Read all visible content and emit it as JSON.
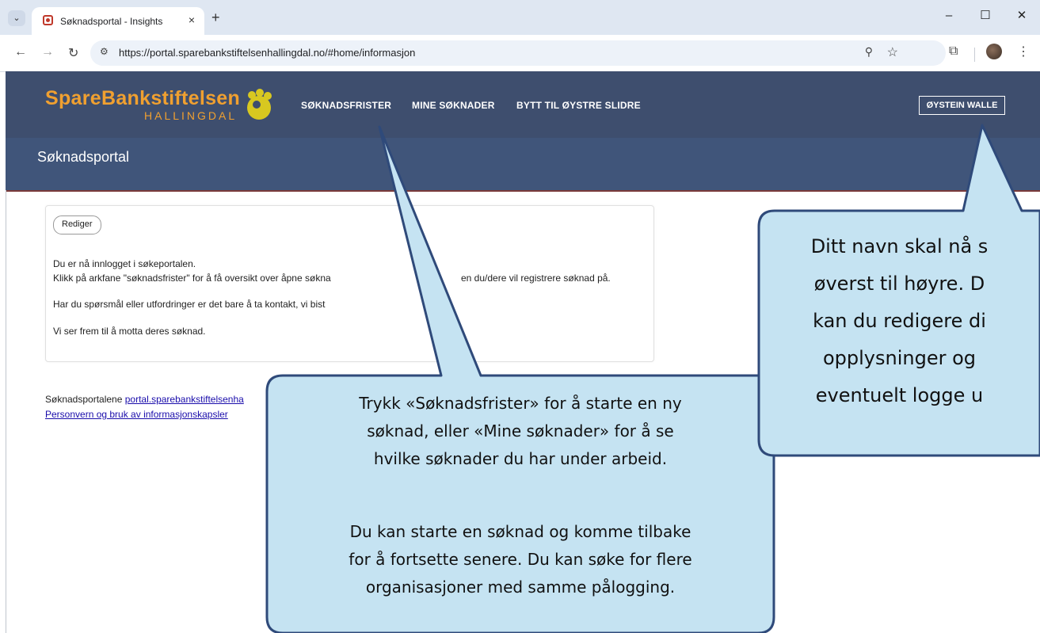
{
  "browser": {
    "tab_title": "Søknadsportal - Insights",
    "tab_close": "×",
    "new_tab": "+",
    "url": "https://portal.sparebankstiftelsenhallingdal.no/#home/informasjon",
    "window_controls": {
      "minimize": "–",
      "maximize": "☐",
      "close": "✕"
    },
    "icons": {
      "menu": "chevron-down-icon",
      "back": "back-arrow-icon",
      "forward": "forward-arrow-icon",
      "reload": "reload-icon",
      "zoom": "zoom-icon",
      "bookmark": "star-icon",
      "extensions": "puzzle-icon",
      "more": "kebab-icon"
    }
  },
  "site": {
    "logo_main": "SpareBankstiftelsen",
    "logo_sub": "HALLINGDAL",
    "nav": {
      "deadlines": "SØKNADSFRISTER",
      "my_applications": "MINE SØKNADER",
      "switch": "BYTT TIL ØYSTRE SLIDRE"
    },
    "user": "ØYSTEIN WALLE",
    "page_title": "Søknadsportal",
    "brand_color": "#f0a030",
    "header_color": "#3e4e6e"
  },
  "content": {
    "edit_label": "Rediger",
    "line1": "Du er nå innlogget i søkeportalen.",
    "line2": "Klikk på arkfane \"søknadsfrister\" for å få oversikt over åpne søkna",
    "line2b": "en du/dere vil registrere søknad på.",
    "line3": "Har du spørsmål eller utfordringer er det bare å ta kontakt, vi bist",
    "line4": "Vi ser frem til å motta deres søknad.",
    "footer_prefix": "Søknadsportalene ",
    "footer_link": "portal.sparebankstiftelsenha",
    "privacy_link": "Personvern og bruk av informasjonskapsler"
  },
  "callouts": {
    "nav_tip": [
      "Trykk «Søknadsfrister» for å starte en ny",
      "søknad, eller «Mine søknader» for å se",
      "hvilke søknader du har under arbeid."
    ],
    "nav_tip2": [
      "Du kan starte en søknad og komme tilbake",
      "for å fortsette senere. Du kan søke for flere",
      "organisasjoner med samme pålogging."
    ],
    "user_tip": [
      "Ditt navn skal nå s",
      "øverst til høyre. D",
      "kan du redigere di",
      "opplysninger og",
      "eventuelt logge u"
    ],
    "fill_color": "#c5e3f2",
    "stroke_color": "#2f4a7a"
  }
}
